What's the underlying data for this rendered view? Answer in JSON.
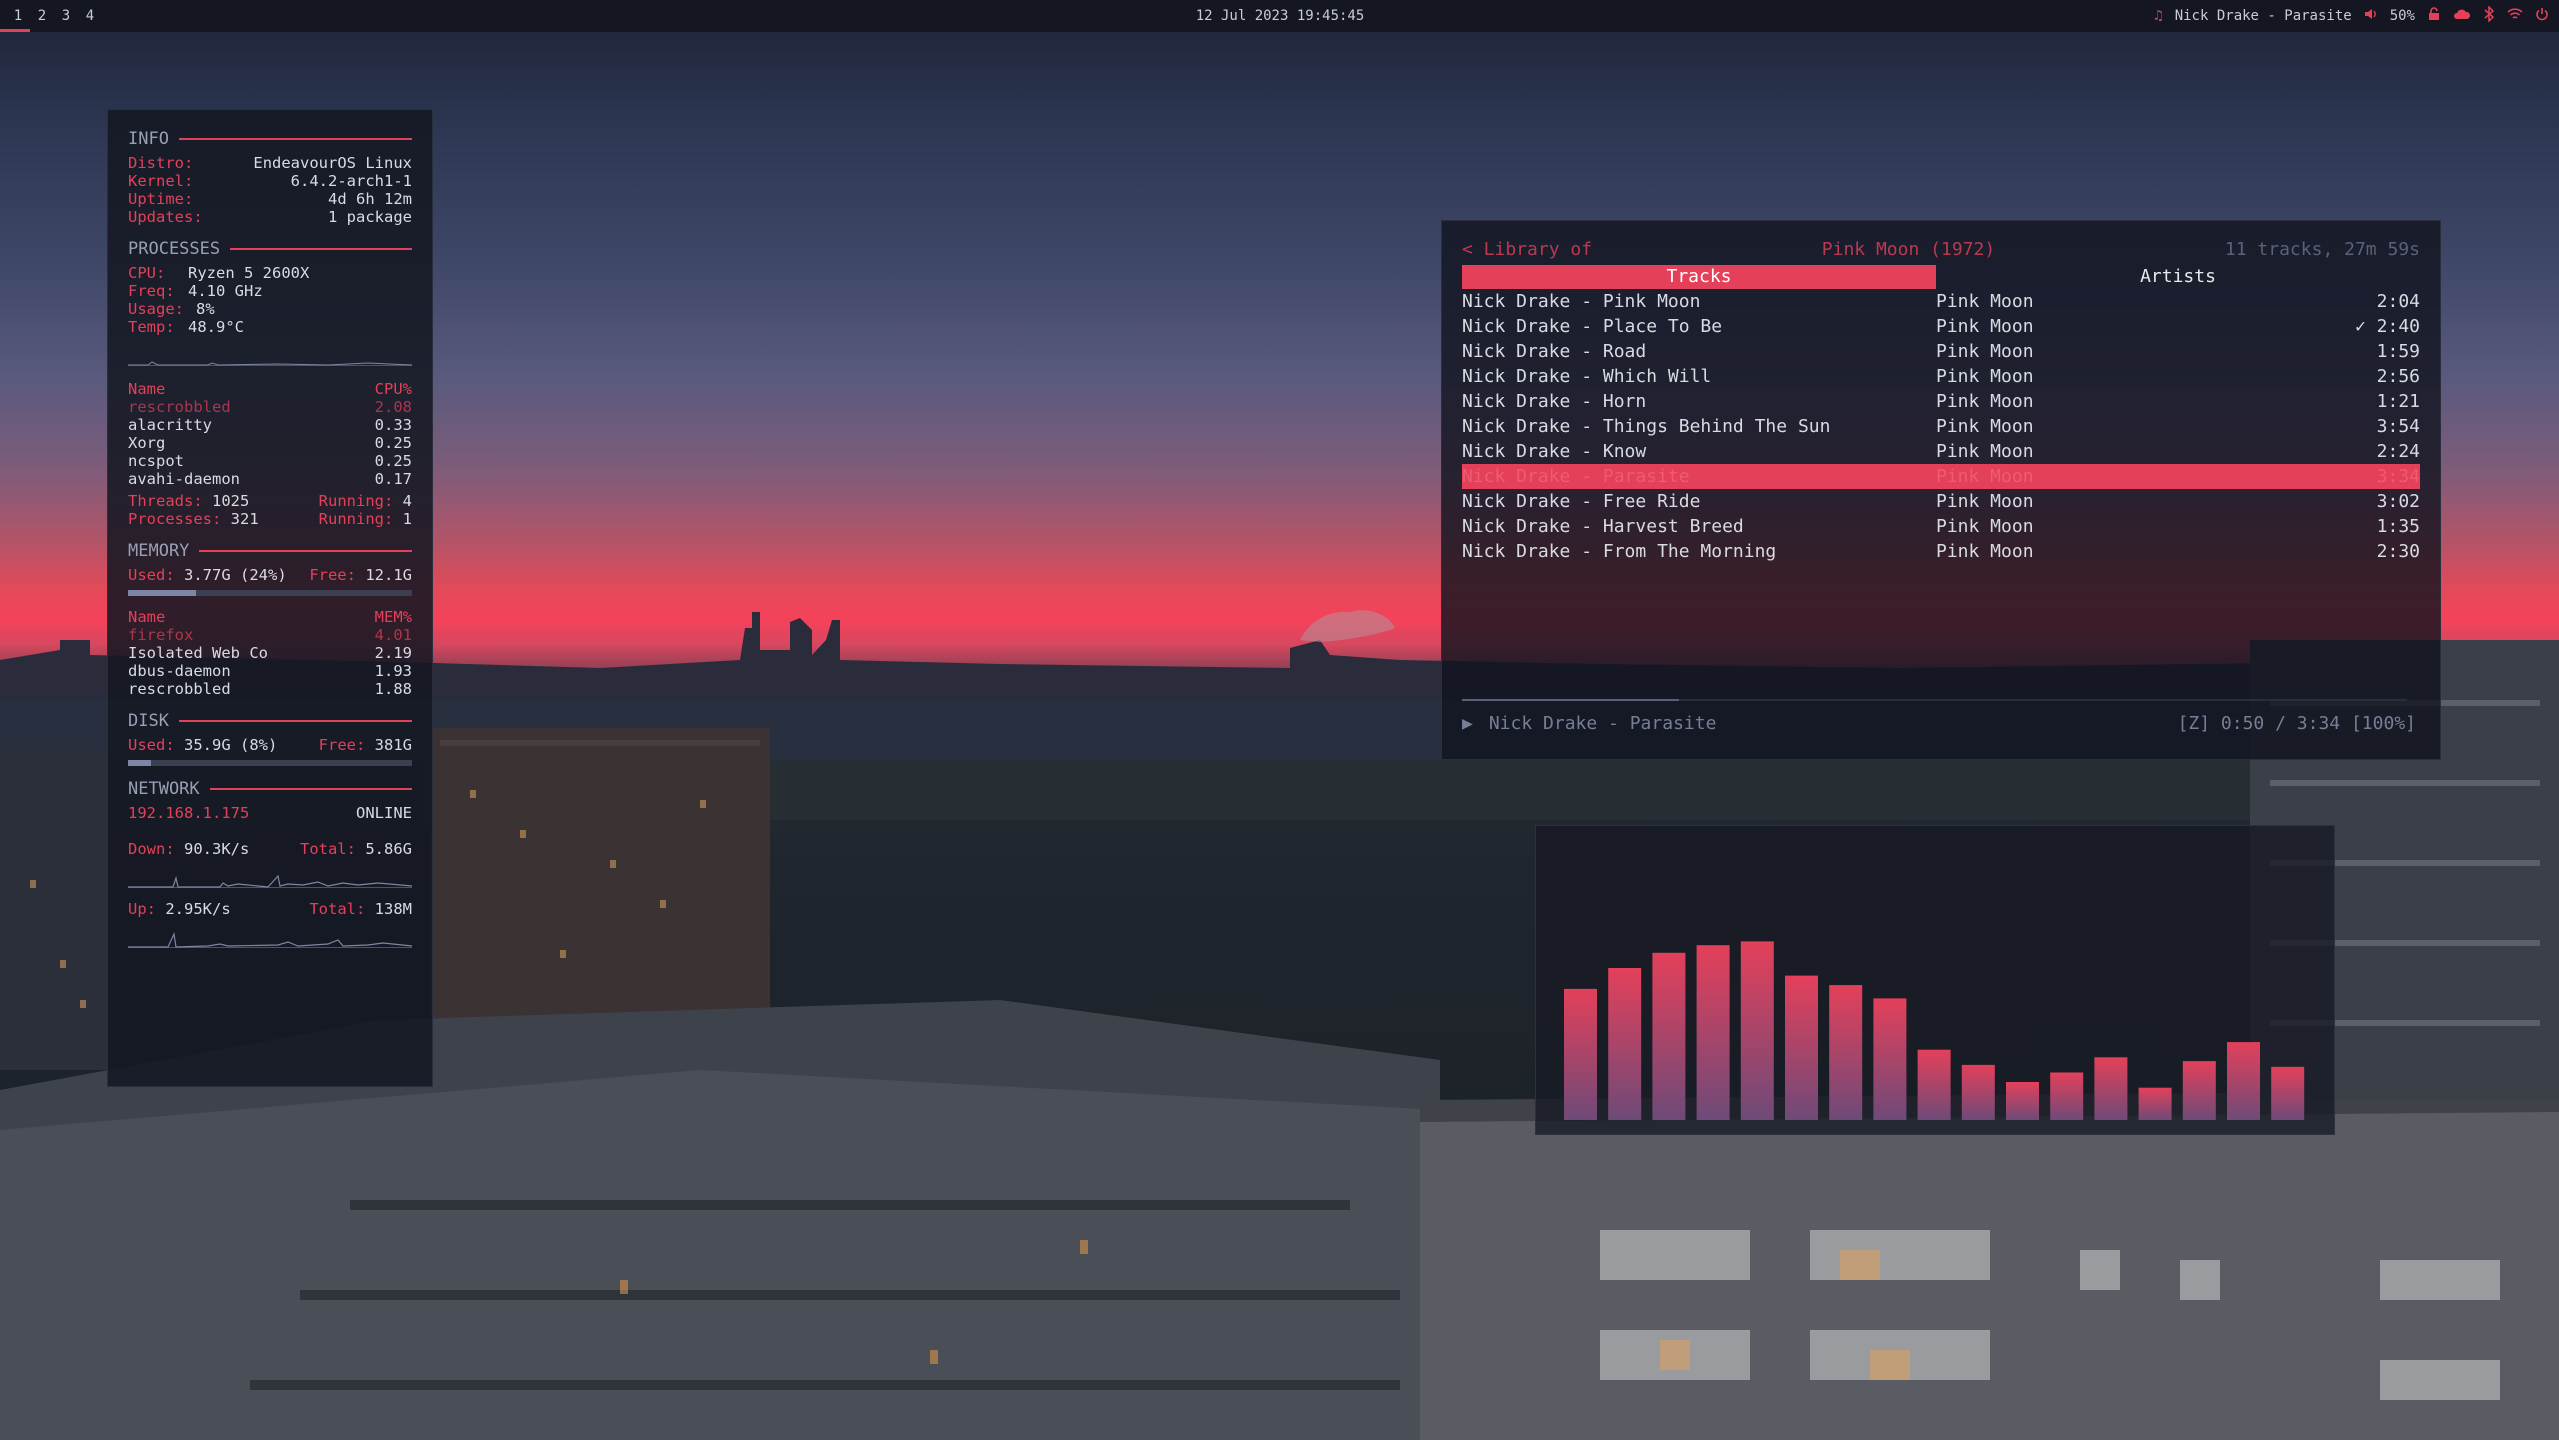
{
  "topbar": {
    "workspaces": [
      "1",
      "2",
      "3",
      "4"
    ],
    "active_workspace": "1",
    "clock": "12 Jul 2023 19:45:45",
    "now_playing": "Nick Drake - Parasite",
    "volume": "50%",
    "icons": [
      "music-note-icon",
      "volume-icon",
      "lock-icon",
      "cloud-icon",
      "bluetooth-icon",
      "wifi-icon",
      "power-icon"
    ]
  },
  "conky": {
    "info": {
      "title": "INFO",
      "distro_label": "Distro:",
      "distro": "EndeavourOS Linux",
      "kernel_label": "Kernel:",
      "kernel": "6.4.2-arch1-1",
      "uptime_label": "Uptime:",
      "uptime": "4d 6h 12m",
      "updates_label": "Updates:",
      "updates": "1 package"
    },
    "processes": {
      "title": "PROCESSES",
      "cpu_label": "CPU:",
      "cpu": "Ryzen 5 2600X",
      "freq_label": "Freq:",
      "freq": "4.10 GHz",
      "usage_label": "Usage:",
      "usage": "8%",
      "temp_label": "Temp:",
      "temp": "48.9°C",
      "col_name": "Name",
      "col_cpu": "CPU%",
      "list": [
        {
          "name": "rescrobbled",
          "value": "2.08"
        },
        {
          "name": "alacritty",
          "value": "0.33"
        },
        {
          "name": "Xorg",
          "value": "0.25"
        },
        {
          "name": "ncspot",
          "value": "0.25"
        },
        {
          "name": "avahi-daemon",
          "value": "0.17"
        }
      ],
      "threads_label": "Threads:",
      "threads": "1025",
      "running_label": "Running:",
      "threads_running": "4",
      "procs_label": "Processes:",
      "procs": "321",
      "procs_running": "1"
    },
    "memory": {
      "title": "MEMORY",
      "used_label": "Used:",
      "used": "3.77G (24%)",
      "free_label": "Free:",
      "free": "12.1G",
      "used_fraction": 0.24,
      "col_name": "Name",
      "col_mem": "MEM%",
      "list": [
        {
          "name": "firefox",
          "value": "4.01"
        },
        {
          "name": "Isolated Web Co",
          "value": "2.19"
        },
        {
          "name": "dbus-daemon",
          "value": "1.93"
        },
        {
          "name": "rescrobbled",
          "value": "1.88"
        }
      ]
    },
    "disk": {
      "title": "DISK",
      "used_label": "Used:",
      "used": "35.9G (8%)",
      "free_label": "Free:",
      "free": "381G",
      "used_fraction": 0.08
    },
    "network": {
      "title": "NETWORK",
      "ip": "192.168.1.175",
      "status": "ONLINE",
      "down_label": "Down:",
      "down": "90.3K/s",
      "down_total_label": "Total:",
      "down_total": "5.86G",
      "up_label": "Up:",
      "up": "2.95K/s",
      "up_total_label": "Total:",
      "up_total": "138M"
    }
  },
  "player": {
    "back": "< Library of",
    "album": "Pink Moon (1972)",
    "summary": "11 tracks, 27m 59s",
    "tab_tracks": "Tracks",
    "tab_artists": "Artists",
    "tracks": [
      {
        "name": "Nick Drake - Pink Moon",
        "album": "Pink Moon",
        "time": "2:04"
      },
      {
        "name": "Nick Drake - Place To Be",
        "album": "Pink Moon",
        "time": "✓ 2:40"
      },
      {
        "name": "Nick Drake - Road",
        "album": "Pink Moon",
        "time": "1:59"
      },
      {
        "name": "Nick Drake - Which Will",
        "album": "Pink Moon",
        "time": "2:56"
      },
      {
        "name": "Nick Drake - Horn",
        "album": "Pink Moon",
        "time": "1:21"
      },
      {
        "name": "Nick Drake - Things Behind The Sun",
        "album": "Pink Moon",
        "time": "3:54"
      },
      {
        "name": "Nick Drake - Know",
        "album": "Pink Moon",
        "time": "2:24"
      },
      {
        "name": "Nick Drake - Parasite",
        "album": "Pink Moon",
        "time": "3:34"
      },
      {
        "name": "Nick Drake - Free Ride",
        "album": "Pink Moon",
        "time": "3:02"
      },
      {
        "name": "Nick Drake - Harvest Breed",
        "album": "Pink Moon",
        "time": "1:35"
      },
      {
        "name": "Nick Drake - From The Morning",
        "album": "Pink Moon",
        "time": "2:30"
      }
    ],
    "playing_index": 7,
    "play_icon": "▶",
    "now_playing": "Nick Drake - Parasite",
    "status": "[Z] 0:50 / 3:34 [100%]",
    "progress_fraction": 0.23
  },
  "visualizer": {
    "levels": [
      0.69,
      0.8,
      0.88,
      0.92,
      0.94,
      0.76,
      0.71,
      0.64,
      0.37,
      0.29,
      0.2,
      0.25,
      0.33,
      0.17,
      0.31,
      0.41,
      0.28
    ],
    "color_top": "#e4405a",
    "color_bottom": "#6e4a78"
  }
}
